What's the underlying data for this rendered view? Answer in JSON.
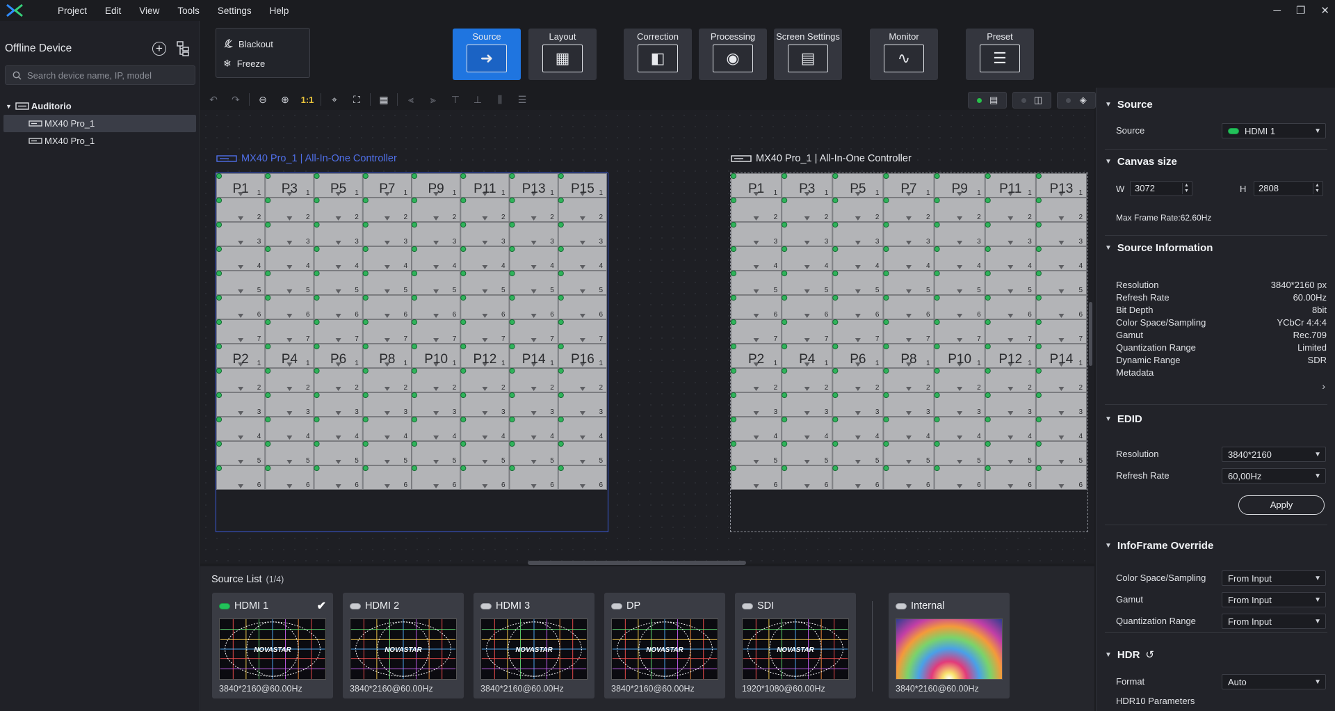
{
  "menubar": {
    "items": [
      "Project",
      "Edit",
      "View",
      "Tools",
      "Settings",
      "Help"
    ],
    "logo": "novastar-logo"
  },
  "left_panel": {
    "title": "Offline Device",
    "search_placeholder": "Search device name, IP, model",
    "tree": {
      "root": "Auditorio",
      "children": [
        "MX40 Pro_1",
        "MX40 Pro_1"
      ]
    }
  },
  "quick": {
    "blackout": "Blackout",
    "freeze": "Freeze"
  },
  "modules": [
    "Source",
    "Layout",
    "Correction",
    "Processing",
    "Screen Settings",
    "Monitor",
    "Preset"
  ],
  "canvas_toolbar": {
    "ratio_label": "1:1"
  },
  "screens": [
    {
      "label": "MX40 Pro_1 | All-In-One Controller",
      "selected": true,
      "ports_top": [
        "P1",
        "P3",
        "P5",
        "P7",
        "P9",
        "P11",
        "P13",
        "P15"
      ],
      "ports_bottom": [
        "P2",
        "P4",
        "P6",
        "P8",
        "P10",
        "P12",
        "P14",
        "P16"
      ]
    },
    {
      "label": "MX40 Pro_1 | All-In-One Controller",
      "selected": false,
      "ports_top": [
        "P1",
        "P3",
        "P5",
        "P7",
        "P9",
        "P11",
        "P13"
      ],
      "ports_bottom": [
        "P2",
        "P4",
        "P6",
        "P8",
        "P10",
        "P12",
        "P14"
      ]
    }
  ],
  "source_list": {
    "title": "Source List",
    "count": "(1/4)",
    "sources": [
      {
        "name": "HDMI 1",
        "res": "3840*2160@60.00Hz",
        "active": true,
        "checked": true
      },
      {
        "name": "HDMI 2",
        "res": "3840*2160@60.00Hz",
        "active": false,
        "checked": false
      },
      {
        "name": "HDMI 3",
        "res": "3840*2160@60.00Hz",
        "active": false,
        "checked": false
      },
      {
        "name": "DP",
        "res": "3840*2160@60.00Hz",
        "active": false,
        "checked": false
      },
      {
        "name": "SDI",
        "res": "1920*1080@60.00Hz",
        "active": false,
        "checked": false
      },
      {
        "name": "Internal",
        "res": "3840*2160@60.00Hz",
        "active": false,
        "checked": false
      }
    ],
    "thumb_brand": "NOVASTAR"
  },
  "right_panel": {
    "source": {
      "heading": "Source",
      "label": "Source",
      "value": "HDMI 1"
    },
    "canvas": {
      "heading": "Canvas size",
      "w_label": "W",
      "w": "3072",
      "h_label": "H",
      "h": "2808",
      "max_frame": "Max Frame Rate:62.60Hz"
    },
    "source_info": {
      "heading": "Source Information",
      "rows": [
        {
          "k": "Resolution",
          "v": "3840*2160 px"
        },
        {
          "k": "Refresh Rate",
          "v": "60.00Hz"
        },
        {
          "k": "Bit Depth",
          "v": "8bit"
        },
        {
          "k": "Color Space/Sampling",
          "v": "YCbCr 4:4:4"
        },
        {
          "k": "Gamut",
          "v": "Rec.709"
        },
        {
          "k": "Quantization Range",
          "v": "Limited"
        },
        {
          "k": "Dynamic Range",
          "v": "SDR"
        },
        {
          "k": "Metadata",
          "v": ""
        }
      ]
    },
    "edid": {
      "heading": "EDID",
      "res_label": "Resolution",
      "res": "3840*2160",
      "rate_label": "Refresh Rate",
      "rate": "60,00Hz",
      "apply": "Apply"
    },
    "infoframe": {
      "heading": "InfoFrame Override",
      "rows": [
        {
          "k": "Color Space/Sampling",
          "v": "From Input"
        },
        {
          "k": "Gamut",
          "v": "From Input"
        },
        {
          "k": "Quantization Range",
          "v": "From Input"
        }
      ]
    },
    "hdr": {
      "heading": "HDR",
      "format_label": "Format",
      "format": "Auto",
      "params": "HDR10 Parameters"
    }
  },
  "colors": {
    "accent": "#1f75e0",
    "active_led": "#22c25a",
    "screen_selected": "#3b5bdb"
  }
}
